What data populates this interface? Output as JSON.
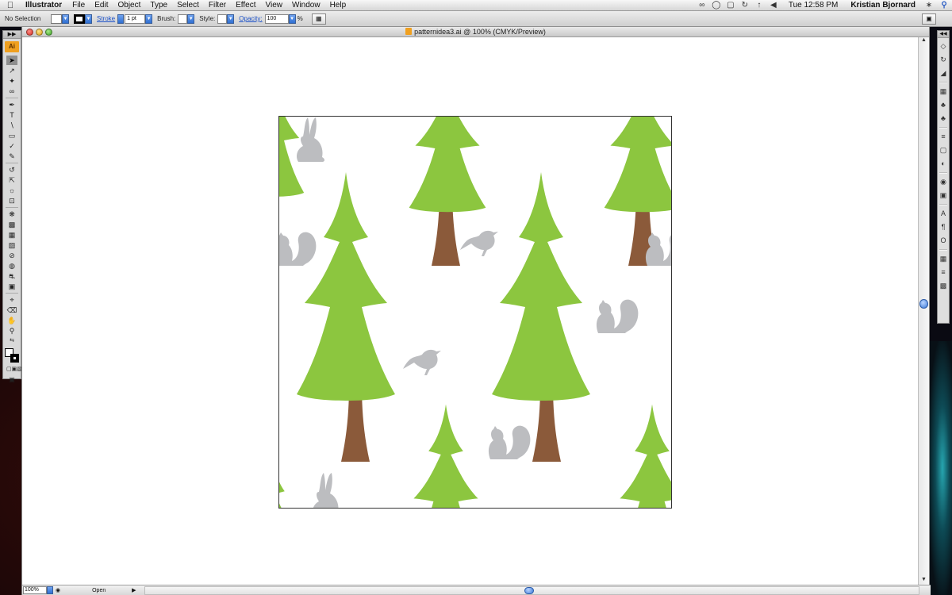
{
  "menubar": {
    "apple_icon": "apple-icon",
    "app_name": "Illustrator",
    "menus": [
      "File",
      "Edit",
      "Object",
      "Type",
      "Select",
      "Filter",
      "Effect",
      "View",
      "Window",
      "Help"
    ],
    "status_icons": [
      "creative-suite-icon",
      "time-machine-icon",
      "display-icon",
      "sync-icon",
      "wifi-icon",
      "volume-icon"
    ],
    "clock": "Tue 12:58 PM",
    "user": "Kristian Bjornard",
    "spotlight_icon": "spotlight-icon"
  },
  "controlbar": {
    "selection": "No Selection",
    "stroke_label": "Stroke",
    "stroke_value": "1 pt",
    "brush_label": "Brush:",
    "style_label": "Style:",
    "opacity_label": "Opacity:",
    "opacity_value": "100",
    "opacity_unit": "%"
  },
  "toolbox": {
    "logo": "Ai",
    "tools": [
      "selection-tool-icon",
      "direct-selection-tool-icon",
      "magic-wand-tool-icon",
      "lasso-tool-icon",
      "pen-tool-icon",
      "type-tool-icon",
      "line-segment-tool-icon",
      "rectangle-tool-icon",
      "paintbrush-tool-icon",
      "pencil-tool-icon",
      "rotate-tool-icon",
      "scale-tool-icon",
      "warp-tool-icon",
      "free-transform-tool-icon",
      "symbol-sprayer-tool-icon",
      "column-graph-tool-icon",
      "mesh-tool-icon",
      "gradient-tool-icon",
      "eyedropper-tool-icon",
      "blend-tool-icon",
      "live-paint-bucket-tool-icon",
      "live-paint-selection-tool-icon",
      "crop-area-tool-icon",
      "eraser-tool-icon",
      "hand-tool-icon",
      "zoom-tool-icon"
    ]
  },
  "document": {
    "title": "patternidea3.ai @ 100% (CMYK/Preview)",
    "zoom": "100%",
    "status": "Open"
  },
  "artwork": {
    "colors": {
      "tree_green": "#8cc63f",
      "trunk_brown": "#8b5a3a",
      "animal_gray": "#bcbdc0"
    },
    "animals": [
      "rabbit",
      "bird",
      "squirrel",
      "bird",
      "squirrel",
      "squirrel",
      "rabbit",
      "squirrel"
    ]
  },
  "rightdock": {
    "icons": [
      "layers-icon",
      "navigator-icon",
      "info-icon",
      "swatches-icon",
      "symbols-icon",
      "brushes-icon",
      "stroke-icon",
      "gradient-icon",
      "transparency-icon",
      "appearance-icon",
      "graphic-styles-icon",
      "character-icon",
      "paragraph-icon",
      "opentype-icon",
      "transform-icon",
      "align-icon",
      "pathfinder-icon"
    ]
  }
}
